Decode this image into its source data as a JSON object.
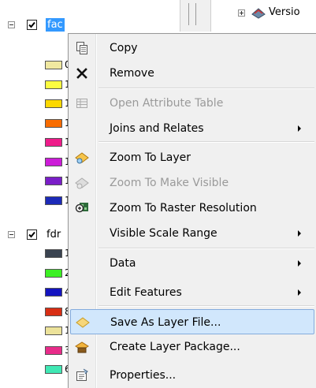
{
  "toc": {
    "layer1": {
      "name": "fac",
      "checked": true
    },
    "layer2": {
      "name": "fdr",
      "checked": true
    },
    "tree": {
      "version_label": "Versio"
    },
    "fac_swatches": [
      {
        "color": "#f0e8a0",
        "label": "0"
      },
      {
        "color": "#fcfc40",
        "label": "1"
      },
      {
        "color": "#fcd800",
        "label": "1"
      },
      {
        "color": "#f86c00",
        "label": "1"
      },
      {
        "color": "#ee1c8a",
        "label": "1"
      },
      {
        "color": "#cc1cd8",
        "label": "1"
      },
      {
        "color": "#7a1ec8",
        "label": "1"
      },
      {
        "color": "#1c2ab8",
        "label": "1"
      }
    ],
    "fdr_swatches": [
      {
        "color": "#3a4350",
        "label": "1"
      },
      {
        "color": "#3cf024",
        "label": "2"
      },
      {
        "color": "#1414c0",
        "label": "4"
      },
      {
        "color": "#d82e14",
        "label": "8"
      },
      {
        "color": "#ece29a",
        "label": "1"
      },
      {
        "color": "#e82c8a",
        "label": "3"
      },
      {
        "color": "#40e8b4",
        "label": "6"
      }
    ]
  },
  "menu": {
    "items": [
      {
        "label": "Copy",
        "icon": "copy-icon",
        "disabled": false,
        "submenu": false
      },
      {
        "label": "Remove",
        "icon": "remove-icon",
        "disabled": false,
        "submenu": false
      },
      {
        "label": "Open Attribute Table",
        "icon": "table-icon",
        "disabled": true,
        "submenu": false
      },
      {
        "label": "Joins and Relates",
        "icon": "",
        "disabled": false,
        "submenu": true
      },
      {
        "label": "Zoom To Layer",
        "icon": "zoom-to-layer-icon",
        "disabled": false,
        "submenu": false
      },
      {
        "label": "Zoom To Make Visible",
        "icon": "zoom-visible-icon",
        "disabled": true,
        "submenu": false
      },
      {
        "label": "Zoom To Raster Resolution",
        "icon": "raster-resolution-icon",
        "disabled": false,
        "submenu": false
      },
      {
        "label": "Visible Scale Range",
        "icon": "",
        "disabled": false,
        "submenu": true
      },
      {
        "label": "Data",
        "icon": "",
        "disabled": false,
        "submenu": true
      },
      {
        "label": "Edit Features",
        "icon": "",
        "disabled": false,
        "submenu": true
      },
      {
        "label": "Save As Layer File...",
        "icon": "save-layer-icon",
        "disabled": false,
        "submenu": false,
        "highlighted": true
      },
      {
        "label": "Create Layer Package...",
        "icon": "layer-package-icon",
        "disabled": false,
        "submenu": false
      },
      {
        "label": "Properties...",
        "icon": "properties-icon",
        "disabled": false,
        "submenu": false
      }
    ]
  },
  "colors": {
    "selection": "#3399ff",
    "menu_highlight": "#d1e7fc",
    "menu_highlight_border": "#84acdd",
    "menu_bg": "#f0f0f0"
  }
}
